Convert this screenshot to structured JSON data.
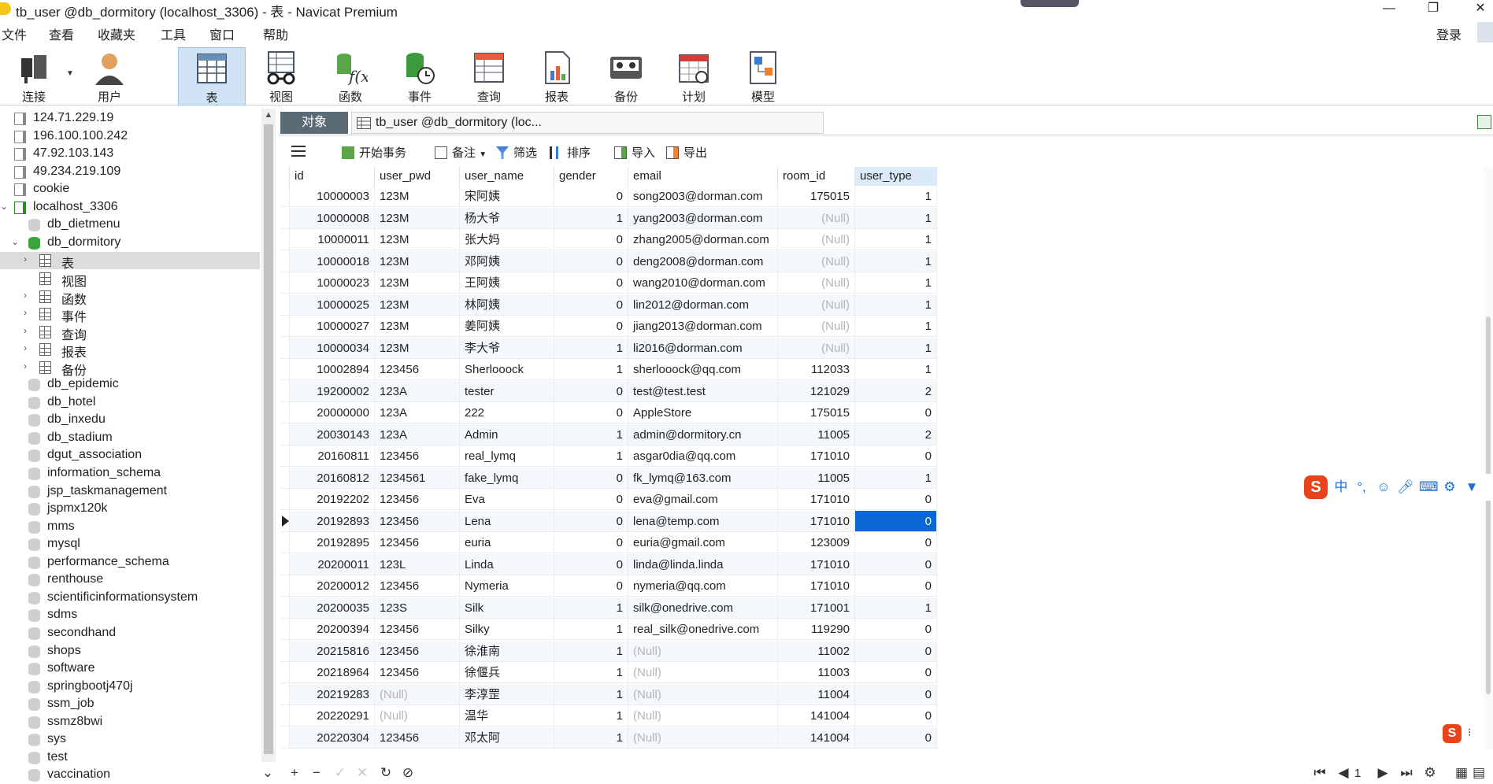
{
  "window": {
    "title": "tb_user @db_dormitory (localhost_3306) - 表 - Navicat Premium",
    "minimize": "—",
    "restore": "❐",
    "close": "✕"
  },
  "menu": {
    "items": [
      "文件",
      "查看",
      "收藏夹",
      "工具",
      "窗口",
      "帮助"
    ],
    "login": "登录"
  },
  "toolbar": {
    "connect": "连接",
    "user": "用户",
    "table": "表",
    "view": "视图",
    "function": "函数",
    "event": "事件",
    "query": "查询",
    "report": "报表",
    "backup": "备份",
    "schedule": "计划",
    "model": "模型"
  },
  "sidebar": {
    "rows": [
      {
        "label": "124.71.229.19",
        "icon": "server-icon"
      },
      {
        "label": "196.100.100.242",
        "icon": "server-icon"
      },
      {
        "label": "47.92.103.143",
        "icon": "server-icon"
      },
      {
        "label": "49.234.219.109",
        "icon": "server-icon"
      },
      {
        "label": "cookie",
        "icon": "server-icon"
      },
      {
        "label": "localhost_3306",
        "icon": "server-connected-icon",
        "expanded": true
      },
      {
        "label": "db_dietmenu",
        "icon": "database-icon"
      },
      {
        "label": "db_dormitory",
        "icon": "database-open-icon",
        "expanded": true
      },
      {
        "label": "表",
        "icon": "table-icon",
        "selected": true
      },
      {
        "label": "视图",
        "icon": "view-icon"
      },
      {
        "label": "函数",
        "icon": "function-icon"
      },
      {
        "label": "事件",
        "icon": "event-icon"
      },
      {
        "label": "查询",
        "icon": "query-icon"
      },
      {
        "label": "报表",
        "icon": "report-icon"
      },
      {
        "label": "备份",
        "icon": "backup-icon"
      },
      {
        "label": "db_epidemic",
        "icon": "database-icon"
      },
      {
        "label": "db_hotel",
        "icon": "database-icon"
      },
      {
        "label": "db_inxedu",
        "icon": "database-icon"
      },
      {
        "label": "db_stadium",
        "icon": "database-icon"
      },
      {
        "label": "dgut_association",
        "icon": "database-icon"
      },
      {
        "label": "information_schema",
        "icon": "database-icon"
      },
      {
        "label": "jsp_taskmanagement",
        "icon": "database-icon"
      },
      {
        "label": "jspmx120k",
        "icon": "database-icon"
      },
      {
        "label": "mms",
        "icon": "database-icon"
      },
      {
        "label": "mysql",
        "icon": "database-icon"
      },
      {
        "label": "performance_schema",
        "icon": "database-icon"
      },
      {
        "label": "renthouse",
        "icon": "database-icon"
      },
      {
        "label": "scientificinformationsystem",
        "icon": "database-icon"
      },
      {
        "label": "sdms",
        "icon": "database-icon"
      },
      {
        "label": "secondhand",
        "icon": "database-icon"
      },
      {
        "label": "shops",
        "icon": "database-icon"
      },
      {
        "label": "software",
        "icon": "database-icon"
      },
      {
        "label": "springbootj470j",
        "icon": "database-icon"
      },
      {
        "label": "ssm_job",
        "icon": "database-icon"
      },
      {
        "label": "ssmz8bwi",
        "icon": "database-icon"
      },
      {
        "label": "sys",
        "icon": "database-icon"
      },
      {
        "label": "test",
        "icon": "database-icon"
      },
      {
        "label": "vaccination",
        "icon": "database-icon"
      }
    ]
  },
  "tabs": {
    "objects": "对象",
    "document": "tb_user @db_dormitory (loc..."
  },
  "subtoolbar": {
    "begin_transaction": "开始事务",
    "note": "备注",
    "filter": "筛选",
    "sort": "排序",
    "import": "导入",
    "export": "导出"
  },
  "table": {
    "columns": [
      "id",
      "user_pwd",
      "user_name",
      "gender",
      "email",
      "room_id",
      "user_type"
    ],
    "rows": [
      [
        "10000003",
        "123M",
        "宋阿姨",
        "0",
        "song2003@dorman.com",
        "175015",
        "1"
      ],
      [
        "10000008",
        "123M",
        "杨大爷",
        "1",
        "yang2003@dorman.com",
        "(Null)",
        "1"
      ],
      [
        "10000011",
        "123M",
        "张大妈",
        "0",
        "zhang2005@dorman.com",
        "(Null)",
        "1"
      ],
      [
        "10000018",
        "123M",
        "邓阿姨",
        "0",
        "deng2008@dorman.com",
        "(Null)",
        "1"
      ],
      [
        "10000023",
        "123M",
        "王阿姨",
        "0",
        "wang2010@dorman.com",
        "(Null)",
        "1"
      ],
      [
        "10000025",
        "123M",
        "林阿姨",
        "0",
        "lin2012@dorman.com",
        "(Null)",
        "1"
      ],
      [
        "10000027",
        "123M",
        "姜阿姨",
        "0",
        "jiang2013@dorman.com",
        "(Null)",
        "1"
      ],
      [
        "10000034",
        "123M",
        "李大爷",
        "1",
        "li2016@dorman.com",
        "(Null)",
        "1"
      ],
      [
        "10002894",
        "123456",
        "Sherlooock",
        "1",
        "sherlooock@qq.com",
        "112033",
        "1"
      ],
      [
        "19200002",
        "123A",
        "tester",
        "0",
        "test@test.test",
        "121029",
        "2"
      ],
      [
        "20000000",
        "123A",
        "222",
        "0",
        "AppleStore",
        "175015",
        "0"
      ],
      [
        "20030143",
        "123A",
        "Admin",
        "1",
        "admin@dormitory.cn",
        "11005",
        "2"
      ],
      [
        "20160811",
        "123456",
        "real_lymq",
        "1",
        "asgar0dia@qq.com",
        "171010",
        "0"
      ],
      [
        "20160812",
        "1234561",
        "fake_lymq",
        "0",
        "fk_lymq@163.com",
        "11005",
        "1"
      ],
      [
        "20192202",
        "123456",
        "Eva",
        "0",
        "eva@gmail.com",
        "171010",
        "0"
      ],
      [
        "20192893",
        "123456",
        "Lena",
        "0",
        "lena@temp.com",
        "171010",
        "0"
      ],
      [
        "20192895",
        "123456",
        "euria",
        "0",
        "euria@gmail.com",
        "123009",
        "0"
      ],
      [
        "20200011",
        "123L",
        "Linda",
        "0",
        "linda@linda.linda",
        "171010",
        "0"
      ],
      [
        "20200012",
        "123456",
        "Nymeria",
        "0",
        "nymeria@qq.com",
        "171010",
        "0"
      ],
      [
        "20200035",
        "123S",
        "Silk",
        "1",
        "silk@onedrive.com",
        "171001",
        "1"
      ],
      [
        "20200394",
        "123456",
        "Silky",
        "1",
        "real_silk@onedrive.com",
        "119290",
        "0"
      ],
      [
        "20215816",
        "123456",
        "徐淮南",
        "1",
        "(Null)",
        "11002",
        "0"
      ],
      [
        "20218964",
        "123456",
        "徐偃兵",
        "1",
        "(Null)",
        "11003",
        "0"
      ],
      [
        "20219283",
        "(Null)",
        "李淳罡",
        "1",
        "(Null)",
        "11004",
        "0"
      ],
      [
        "20220291",
        "(Null)",
        "温华",
        "1",
        "(Null)",
        "141004",
        "0"
      ],
      [
        "20220304",
        "123456",
        "邓太阿",
        "1",
        "(Null)",
        "141004",
        "0"
      ]
    ],
    "current_row": 15,
    "selected_column": "user_type"
  },
  "ime": {
    "logo": "S",
    "mode": "中",
    "punct": "°,"
  },
  "bottombar": {
    "page": "1"
  },
  "colors": {
    "accent": "#0a68d4",
    "selected_tool": "#cfe3f5",
    "tab_objects": "#5b6b75",
    "null_text": "#b5b5b5"
  }
}
